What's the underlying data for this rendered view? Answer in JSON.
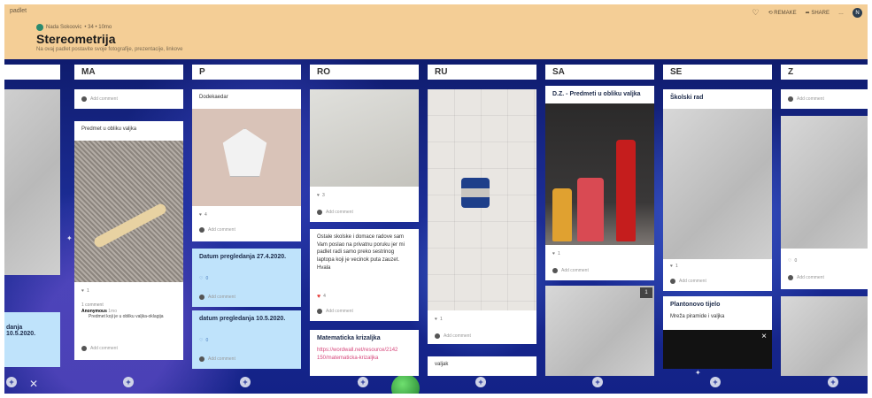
{
  "header": {
    "brand": "padlet",
    "author": "Nada Sokoovic",
    "meta_rest": "• 34 • 10mo",
    "title": "Stereometrija",
    "subtitle": "Na ovaj padlet postavite svoje fotografije, prezentacije, linkove",
    "remake_label": "⟲ REMAKE",
    "share_label": "➦ SHARE",
    "more_label": "…",
    "avatar_initial": "N"
  },
  "colors": {
    "header_bg": "#f4ce96",
    "board_bg": "#1c2d96",
    "card_blue": "#bfe3fb",
    "link": "#d6457a"
  },
  "columns": [
    {
      "name": "",
      "cards": [
        {
          "title": "danja 10.5.2020."
        }
      ]
    },
    {
      "name": "MA",
      "cards": [
        {
          "footer": "Add comment"
        },
        {
          "text": "Predmet u obliku valjka",
          "likes": "1",
          "comments_label": "1 comment",
          "comment_author": "Anonymous",
          "comment_time": "1mo",
          "comment_text": "Predmet koji je u obliku valjka-oklagija",
          "footer": "Add comment"
        }
      ]
    },
    {
      "name": "P",
      "cards": [
        {
          "text": "Dodekaedar",
          "likes": "4",
          "footer": "Add comment"
        },
        {
          "title": "Datum pregledanja 27.4.2020.",
          "likes": "0",
          "footer": "Add comment"
        },
        {
          "title": "datum pregledanja 10.5.2020.",
          "likes": "0",
          "footer": "Add comment"
        }
      ]
    },
    {
      "name": "RO",
      "cards": [
        {
          "likes": "3",
          "footer": "Add comment"
        },
        {
          "text": "Ostale skolske i domace radove sam Vam poslao na privatnu poruku jer mi padlet radi samo preko sestrinog laptopa koji je vecinok puta zauzet. Hvala",
          "likes": "4",
          "footer": "Add comment"
        },
        {
          "title": "Matematicka krizaljka",
          "link": "https://wordwall.net/resource/2142 150/matematicka-krizaljka"
        }
      ]
    },
    {
      "name": "RU",
      "cards": [
        {
          "likes": "1",
          "footer": "Add comment"
        },
        {
          "text": "valjak"
        }
      ]
    },
    {
      "name": "SA",
      "cards": [
        {
          "title": "D.Z. - Predmeti u obliku valjka",
          "likes": "1",
          "footer": "Add comment"
        },
        {
          "badge": "1"
        }
      ]
    },
    {
      "name": "SE",
      "cards": [
        {
          "title": "Školski rad",
          "likes": "1",
          "footer": "Add comment"
        },
        {
          "title": "Plantonovo tijelo",
          "text": "Mreža piramide i valjka",
          "close": "×"
        }
      ]
    },
    {
      "name": "Z",
      "cards": [
        {
          "footer": "Add comment"
        },
        {
          "likes": "0",
          "footer": "Add comment"
        }
      ]
    }
  ],
  "add_button_label": "+"
}
